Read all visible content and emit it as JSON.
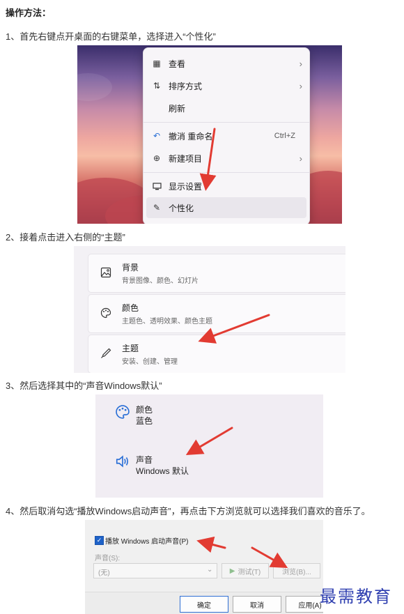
{
  "heading": "操作方法：",
  "steps": [
    "1、首先右键点开桌面的右键菜单，选择进入“个性化”",
    "2、接着点击进入右侧的“主题”",
    "3、然后选择其中的“声音Windows默认”",
    "4、然后取消勾选“播放Windows启动声音”，再点击下方浏览就可以选择我们喜欢的音乐了。"
  ],
  "context_menu": {
    "items": [
      {
        "label": "查看",
        "icon": "grid-icon",
        "submenu": true
      },
      {
        "label": "排序方式",
        "icon": "sort-icon",
        "submenu": true
      },
      {
        "label": "刷新",
        "icon": "",
        "submenu": false
      },
      {
        "label": "撤消 重命名",
        "icon": "undo-icon",
        "shortcut": "Ctrl+Z"
      },
      {
        "label": "新建项目",
        "icon": "plus-circle-icon",
        "submenu": true
      },
      {
        "label": "显示设置",
        "icon": "display-icon"
      },
      {
        "label": "个性化",
        "icon": "pencil-icon",
        "highlighted": true
      }
    ]
  },
  "personalization": {
    "cards": [
      {
        "title": "背景",
        "subtitle": "背景图像、颜色、幻灯片",
        "icon": "image-icon"
      },
      {
        "title": "颜色",
        "subtitle": "主题色、透明效果、颜色主题",
        "icon": "palette-icon"
      },
      {
        "title": "主题",
        "subtitle": "安装、创建、管理",
        "icon": "brush-icon"
      }
    ]
  },
  "theme_items": [
    {
      "title": "颜色",
      "value": "蓝色",
      "icon": "palette-icon"
    },
    {
      "title": "声音",
      "value": "Windows 默认",
      "icon": "speaker-icon"
    }
  ],
  "sound_dialog": {
    "checkbox_label": "播放 Windows 启动声音(P)",
    "checkbox_checked": true,
    "sound_label": "声音(S):",
    "sound_value": "(无)",
    "test_button": "测试(T)",
    "browse_button": "浏览(B)...",
    "ok_button": "确定",
    "cancel_button": "取消",
    "apply_button": "应用(A)"
  },
  "watermark": "最需教育",
  "colors": {
    "accent_blue": "#2a6fd6",
    "arrow_red": "#e23b32",
    "watermark": "#2f3fb0"
  }
}
